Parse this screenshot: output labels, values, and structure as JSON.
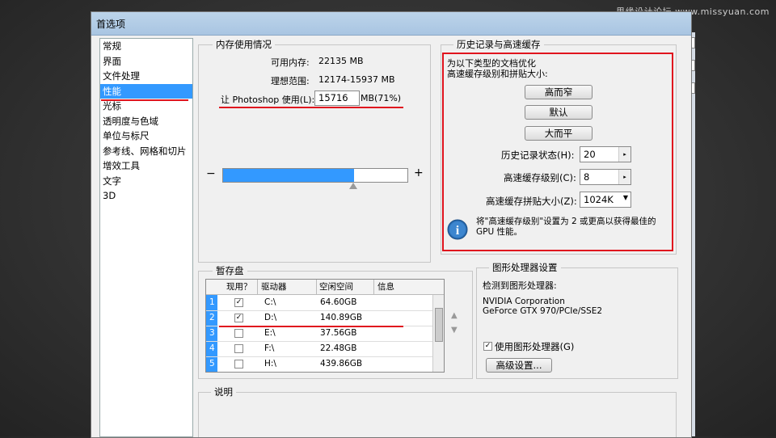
{
  "watermark": "思缘设计论坛 www.missyuan.com",
  "window_title": "首选项",
  "categories": [
    "常规",
    "界面",
    "文件处理",
    "性能",
    "光标",
    "透明度与色域",
    "单位与标尺",
    "参考线、网格和切片",
    "增效工具",
    "文字",
    "3D"
  ],
  "selected_category": "性能",
  "memory": {
    "title": "内存使用情况",
    "available_label": "可用内存:",
    "available_value": "22135 MB",
    "ideal_label": "理想范围:",
    "ideal_value": "12174-15937 MB",
    "let_label": "让 Photoshop 使用(L):",
    "let_value": "15716",
    "let_suffix": "MB(71%)",
    "minus": "−",
    "plus": "+",
    "fill_percent": 71
  },
  "history": {
    "title": "历史记录与高速缓存",
    "desc_line1": "为以下类型的文档优化",
    "desc_line2": "高速缓存级别和拼贴大小:",
    "btn1": "高而窄",
    "btn2": "默认",
    "btn3": "大而平",
    "states_label": "历史记录状态(H):",
    "states_value": "20",
    "levels_label": "高速缓存级别(C):",
    "levels_value": "8",
    "tile_label": "高速缓存拼贴大小(Z):",
    "tile_value": "1024K",
    "info_text_1": "将\"高速缓存级别\"设置为 2 或更高以获得最佳的",
    "info_text_2": "GPU 性能。"
  },
  "scratch": {
    "title": "暂存盘",
    "headers": [
      "现用？",
      "驱动器",
      "空闲空间",
      "信息"
    ],
    "rows": [
      {
        "num": "1",
        "checked": "✓",
        "drive": "C:\\",
        "free": "64.60GB"
      },
      {
        "num": "2",
        "checked": "✓",
        "drive": "D:\\",
        "free": "140.89GB"
      },
      {
        "num": "3",
        "checked": "",
        "drive": "E:\\",
        "free": "37.56GB"
      },
      {
        "num": "4",
        "checked": "",
        "drive": "F:\\",
        "free": "22.48GB"
      },
      {
        "num": "5",
        "checked": "",
        "drive": "H:\\",
        "free": "439.86GB"
      }
    ]
  },
  "gpu": {
    "title": "图形处理器设置",
    "detected_label": "检测到图形处理器:",
    "line1": "NVIDIA Corporation",
    "line2": "GeForce GTX 970/PCIe/SSE2",
    "use_label": "使用图形处理器(G)",
    "use_checked": "✓",
    "advanced": "高级设置..."
  },
  "description_title": "说明",
  "colors": {
    "selection": "#3399ff",
    "highlight_red": "#e0141e",
    "slider_fill": "#3399ff"
  }
}
